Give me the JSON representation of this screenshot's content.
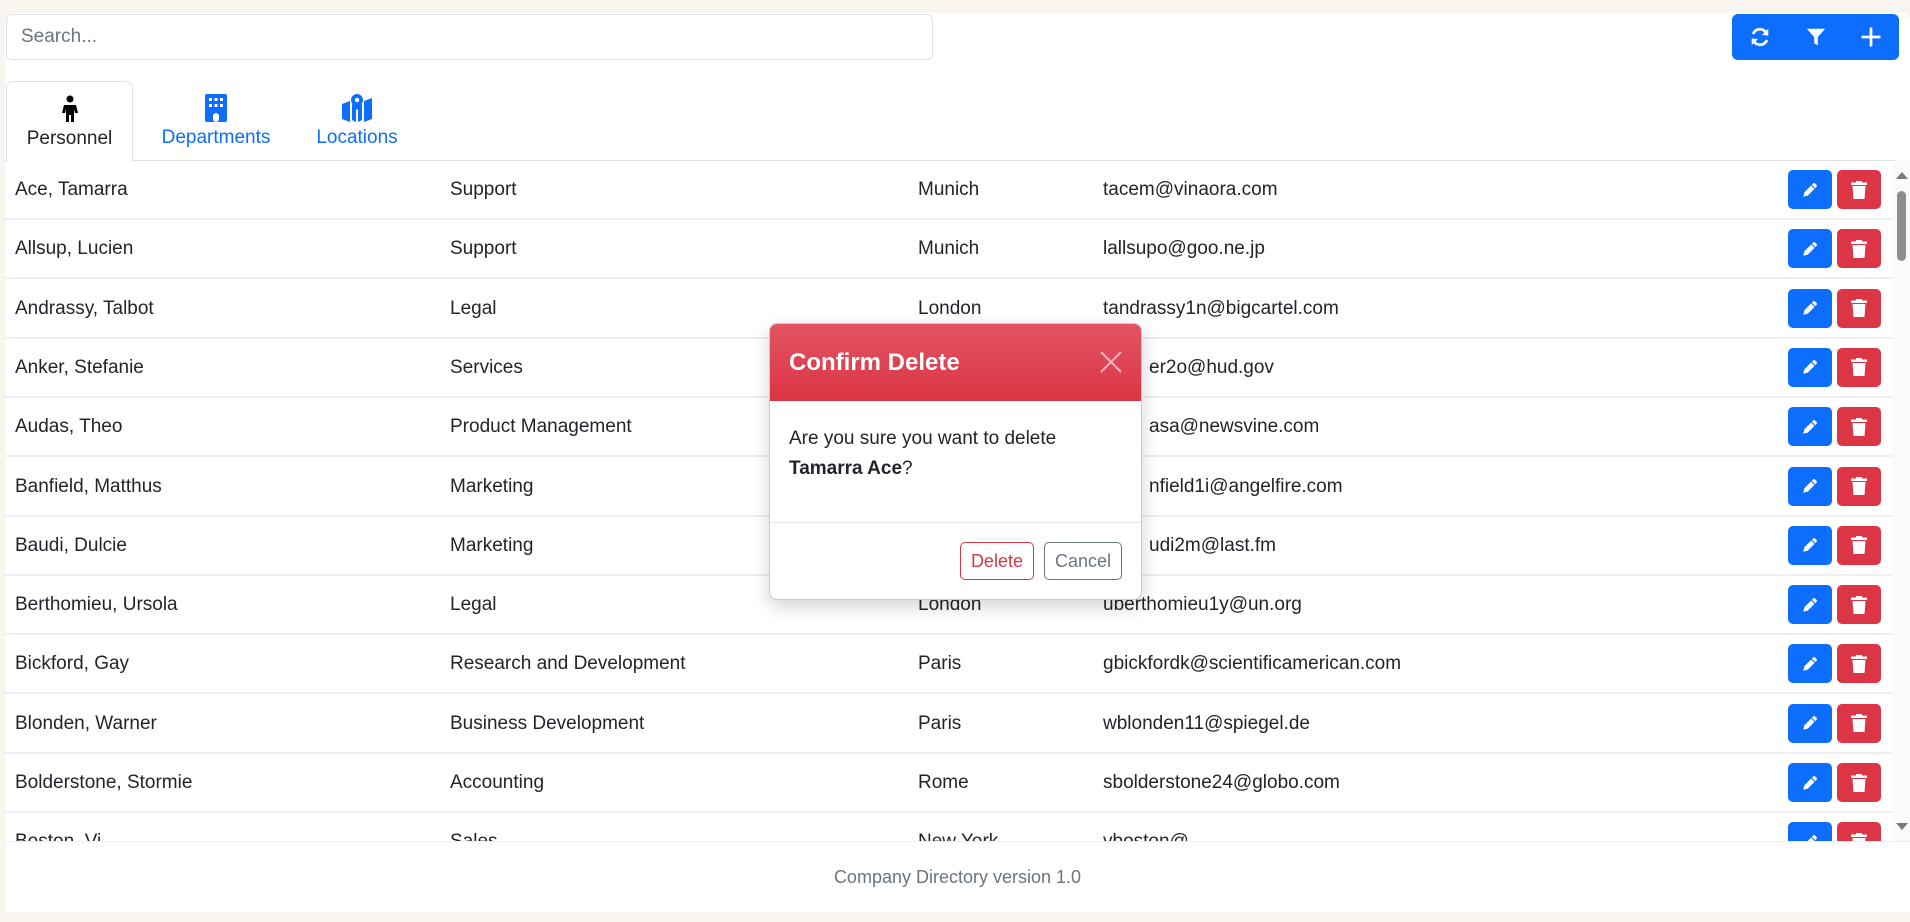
{
  "search": {
    "placeholder": "Search...",
    "value": ""
  },
  "toolbar": {
    "buttons": [
      {
        "icon": "refresh-icon",
        "label": "Refresh"
      },
      {
        "icon": "filter-icon",
        "label": "Filter"
      },
      {
        "icon": "plus-icon",
        "label": "Add"
      }
    ]
  },
  "tabs": [
    {
      "label": "Personnel",
      "icon": "person-icon",
      "active": true
    },
    {
      "label": "Departments",
      "icon": "building-icon",
      "active": false
    },
    {
      "label": "Locations",
      "icon": "map-location-icon",
      "active": false
    }
  ],
  "personnel": [
    {
      "name": "Ace, Tamarra",
      "department": "Support",
      "location": "Munich",
      "email": "tacem@vinaora.com"
    },
    {
      "name": "Allsup, Lucien",
      "department": "Support",
      "location": "Munich",
      "email": "lallsupo@goo.ne.jp"
    },
    {
      "name": "Andrassy, Talbot",
      "department": "Legal",
      "location": "London",
      "email": "tandrassy1n@bigcartel.com"
    },
    {
      "name": "Anker, Stefanie",
      "department": "Services",
      "location": "",
      "email": "er2o@hud.gov"
    },
    {
      "name": "Audas, Theo",
      "department": "Product Management",
      "location": "",
      "email": "asa@newsvine.com"
    },
    {
      "name": "Banfield, Matthus",
      "department": "Marketing",
      "location": "",
      "email": "nfield1i@angelfire.com"
    },
    {
      "name": "Baudi, Dulcie",
      "department": "Marketing",
      "location": "",
      "email": "udi2m@last.fm"
    },
    {
      "name": "Berthomieu, Ursola",
      "department": "Legal",
      "location": "London",
      "email": "uberthomieu1y@un.org"
    },
    {
      "name": "Bickford, Gay",
      "department": "Research and Development",
      "location": "Paris",
      "email": "gbickfordk@scientificamerican.com"
    },
    {
      "name": "Blonden, Warner",
      "department": "Business Development",
      "location": "Paris",
      "email": "wblonden11@spiegel.de"
    },
    {
      "name": "Bolderstone, Stormie",
      "department": "Accounting",
      "location": "Rome",
      "email": "sbolderstone24@globo.com"
    },
    {
      "name": "Boston, Vi",
      "department": "Sales",
      "location": "New York",
      "email": "vboston@"
    }
  ],
  "row_actions": {
    "edit": "Edit",
    "delete": "Delete"
  },
  "modal": {
    "title": "Confirm Delete",
    "message_prefix": "Are you sure you want to delete",
    "target_name": "Tamarra Ace",
    "message_suffix": "?",
    "delete_label": "Delete",
    "cancel_label": "Cancel"
  },
  "footer": {
    "text": "Company Directory version 1.0"
  },
  "colors": {
    "primary": "#0d6efd",
    "danger": "#dc3545",
    "background": "#f7f5ee"
  }
}
